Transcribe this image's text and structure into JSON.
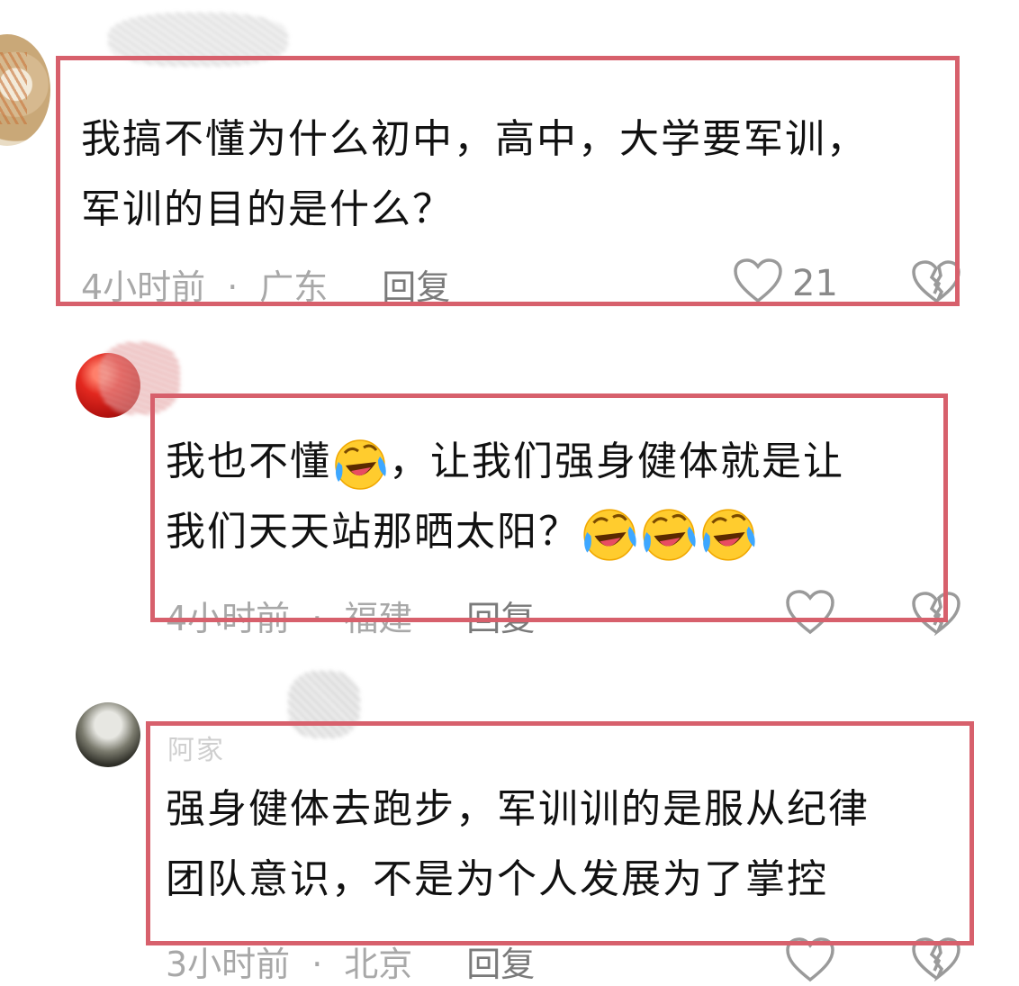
{
  "comments": [
    {
      "lines": [
        "我搞不懂为什么初中，高中，大学要军训，",
        "军训的目的是什么？"
      ],
      "time": "4小时前",
      "location": "广东",
      "reply": "回复",
      "likes": "21"
    },
    {
      "line1_a": "我也不懂",
      "line1_b": "，让我们强身健体就是让",
      "line2": "我们天天站那晒太阳？",
      "time": "4小时前",
      "location": "福建",
      "reply": "回复"
    },
    {
      "username": "阿家",
      "lines": [
        "强身健体去跑步，军训训的是服从纪律",
        "团队意识，不是为个人发展为了掌控"
      ],
      "time": "3小时前",
      "location": "北京",
      "reply": "回复"
    }
  ],
  "icons": {
    "like": "heart-outline-icon",
    "dislike": "broken-heart-icon",
    "emoji": "laughing-crying-emoji"
  },
  "colors": {
    "highlight_box": "#d7606c",
    "meta_text": "#a8a8a8"
  }
}
